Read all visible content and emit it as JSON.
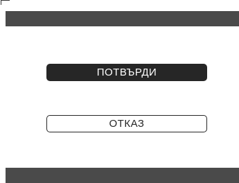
{
  "dialog": {
    "confirm_label": "ПОТВЪРДИ",
    "cancel_label": "ОТКАЗ"
  },
  "colors": {
    "bar": "#4a4a4a",
    "button_fill": "#262626",
    "background": "#ffffff"
  }
}
